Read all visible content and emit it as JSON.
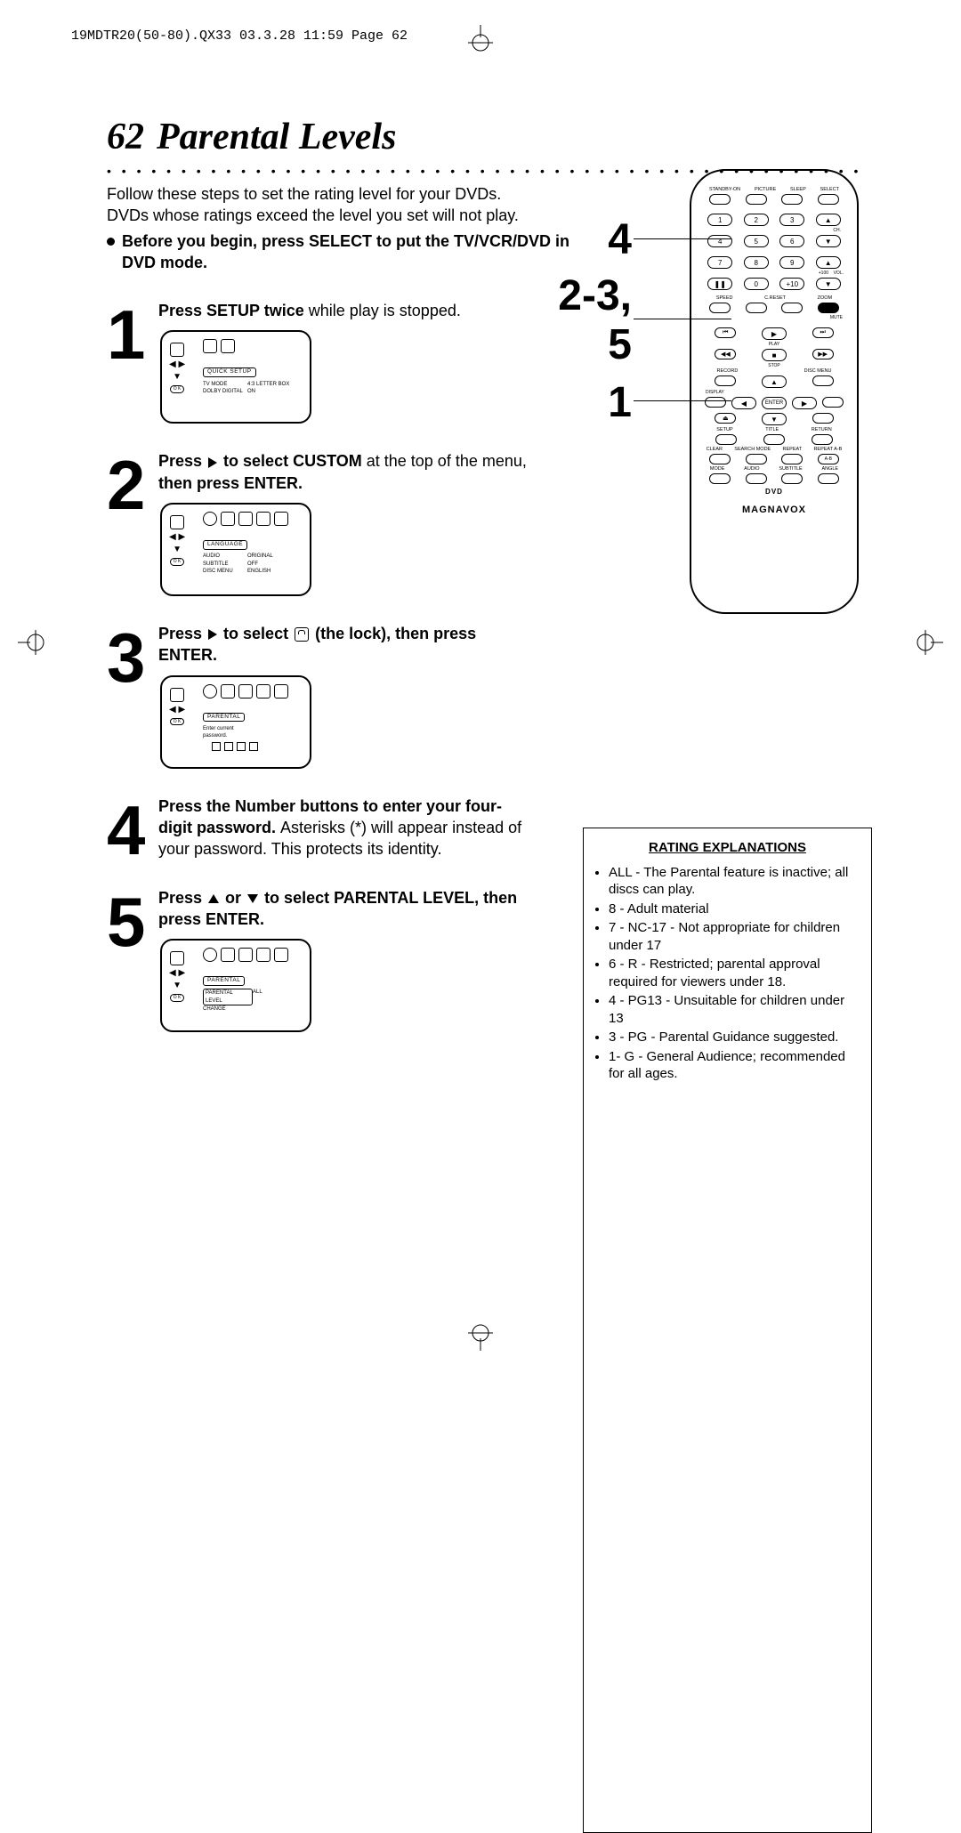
{
  "header": "19MDTR20(50-80).QX33  03.3.28 11:59  Page 62",
  "page_number": "62",
  "title": "Parental Levels",
  "intro": {
    "line1": "Follow these steps to set the rating level for your DVDs.",
    "line2": "DVDs whose ratings exceed the level you set will not play.",
    "bullet_bold": "Before you begin, press SELECT to put the TV/VCR/DVD in DVD mode."
  },
  "steps": {
    "s1": {
      "num": "1",
      "text_bold": "Press SETUP twice ",
      "text_rest": "while play is stopped.",
      "osd_label": "QUICK SETUP",
      "osd_rows": [
        {
          "l": "TV MODE",
          "r": "4:3 LETTER BOX"
        },
        {
          "l": "DOLBY DIGITAL",
          "r": "ON"
        }
      ]
    },
    "s2": {
      "num": "2",
      "text_a": "Press ",
      "text_b": " to select CUSTOM ",
      "text_b_tail": "at the top of the menu, ",
      "text_c": "then press ENTER.",
      "osd_label": "LANGUAGE",
      "osd_rows": [
        {
          "l": "AUDIO",
          "r": "ORIGINAL"
        },
        {
          "l": "SUBTITLE",
          "r": "OFF"
        },
        {
          "l": "DISC MENU",
          "r": "ENGLISH"
        }
      ]
    },
    "s3": {
      "num": "3",
      "text_a": "Press ",
      "text_b": " to select ",
      "text_c": " (the lock), then press ENTER.",
      "osd_label": "PARENTAL",
      "osd_pw_label": "Enter current password."
    },
    "s4": {
      "num": "4",
      "text": "Press the Number buttons to enter your four-digit password. ",
      "text_tail": "Asterisks (*) will appear instead of your password. This protects its identity."
    },
    "s5": {
      "num": "5",
      "text_a": "Press ",
      "text_b": " or ",
      "text_c": " to select PARENTAL LEVEL, then press ENTER.",
      "osd_label": "PARENTAL",
      "osd_rows": [
        {
          "l": "PARENTAL LEVEL",
          "r": "ALL"
        },
        {
          "l": "CHANGE",
          "r": ""
        }
      ]
    }
  },
  "remote": {
    "top_labels": [
      "STANDBY-ON",
      "PICTURE",
      "SLEEP",
      "SELECT"
    ],
    "row_num1": [
      "1",
      "2",
      "3"
    ],
    "row_num2": [
      "4",
      "5",
      "6"
    ],
    "row_num3": [
      "7",
      "8",
      "9"
    ],
    "row_num4": [
      "0",
      "+10"
    ],
    "ch": "CH.",
    "vol": "VOL.",
    "row_mid": [
      "SPEED",
      "C.RESET",
      "ZOOM",
      "MUTE"
    ],
    "play": "PLAY",
    "stop": "STOP",
    "rec_disc": [
      "RECORD",
      "DISC MENU"
    ],
    "display": "DISPLAY",
    "enter": "ENTER",
    "row_setup": [
      "SETUP",
      "TITLE",
      "RETURN"
    ],
    "row_clear": [
      "CLEAR",
      "SEARCH MODE",
      "REPEAT",
      "REPEAT A-B"
    ],
    "row_mode": [
      "MODE",
      "AUDIO",
      "SUBTITLE",
      "ANGLE"
    ],
    "dvd_logo": "DVD",
    "brand": "MAGNAVOX"
  },
  "callouts": {
    "c4": "4",
    "c23": "2-3,",
    "c5": "5",
    "c1": "1"
  },
  "rating_box": {
    "header": "RATING EXPLANATIONS",
    "items": [
      "ALL - The Parental feature is inactive; all discs can play.",
      "8 - Adult material",
      "7 - NC-17 - Not appropriate for children under 17",
      "6 - R - Restricted; parental approval required for viewers under 18.",
      "4 - PG13 - Unsuitable for children under 13",
      "3 - PG - Parental Guidance suggested.",
      "1- G - General Audience; recommended for all ages."
    ]
  }
}
